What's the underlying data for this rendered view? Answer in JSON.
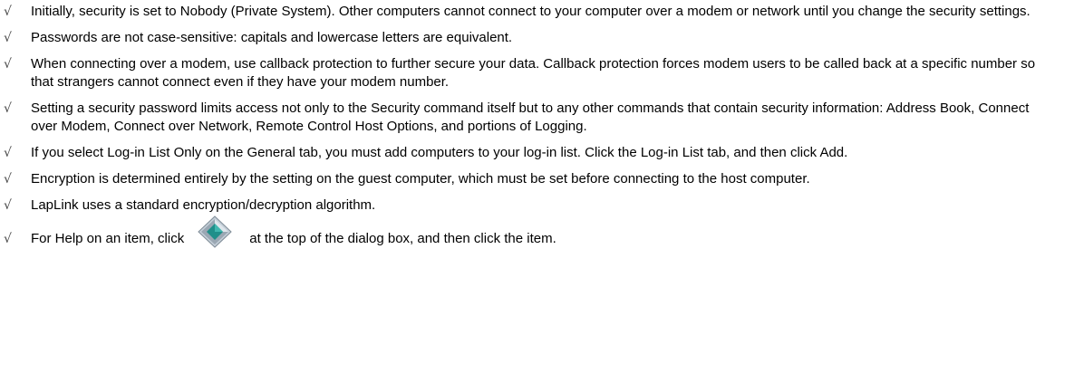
{
  "tips": [
    {
      "bullet": "√",
      "text": "Initially, security is set to Nobody (Private System). Other computers cannot connect to your computer over a modem or network until you change the security settings."
    },
    {
      "bullet": "√",
      "text": "Passwords are not case-sensitive: capitals and lowercase letters are equivalent."
    },
    {
      "bullet": "√",
      "text": "When connecting over a modem, use callback protection to further secure your data. Callback protection forces modem users to be called back at a specific number so that strangers cannot connect even if they have your modem number."
    },
    {
      "bullet": "√",
      "text": "Setting a security password limits access not only to the Security command itself but to any other commands that contain security information: Address Book, Connect over Modem, Connect over Network, Remote Control Host Options, and portions of Logging."
    },
    {
      "bullet": "√",
      "text": "If you select Log-in List Only on the General tab, you must add computers to your log-in list. Click the Log-in List tab, and then click Add."
    },
    {
      "bullet": "√",
      "text": "Encryption is determined entirely by the setting on the guest computer, which must be set before connecting to the host computer."
    },
    {
      "bullet": "√",
      "text": "LapLink uses a standard encryption/decryption algorithm."
    }
  ],
  "help_tip": {
    "bullet": "√",
    "before_icon": "For Help on an item, click",
    "icon": "context-help-diamond-icon",
    "after_icon": "at the top of the dialog box, and then click the item."
  },
  "colors": {
    "text": "#000000",
    "bullet": "#444444",
    "icon_outer": "#9aa7b3",
    "icon_inner": "#1f8f8a"
  }
}
